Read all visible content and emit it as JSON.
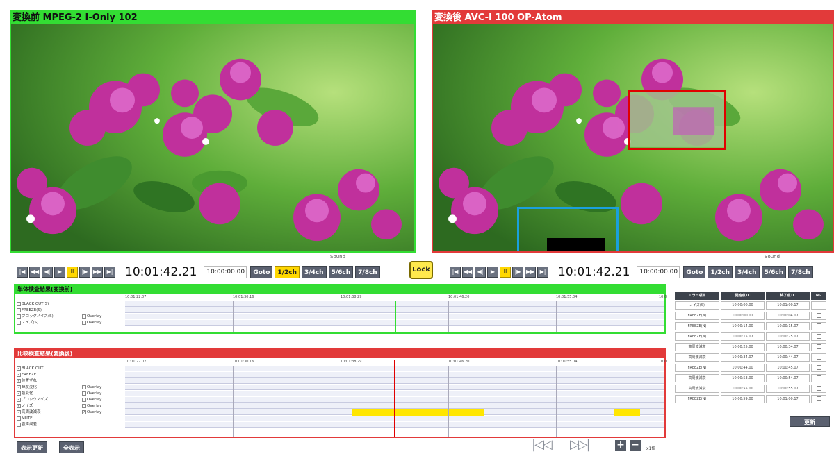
{
  "left_panel": {
    "title": "変換前 MPEG-2 I-Only 102"
  },
  "right_panel": {
    "title": "変換後 AVC-I 100 OP-Atom"
  },
  "sound_label": "Sound",
  "left_transport": {
    "timecode": "10:01:42.21",
    "input": "10:00:00.00",
    "goto": "Goto",
    "channels": [
      "1/2ch",
      "3/4ch",
      "5/6ch",
      "7/8ch"
    ],
    "selected_channel": "1/2ch"
  },
  "right_transport": {
    "timecode": "10:01:42.21",
    "input": "10:00:00.00",
    "goto": "Goto",
    "channels": [
      "1/2ch",
      "3/4ch",
      "5/6ch",
      "7/8ch"
    ],
    "selected_channel": "1/2ch"
  },
  "lock_label": "Lock",
  "single_panel": {
    "title": "単体検査結果(変換前)",
    "ticks": [
      "10:01:22.07",
      "10:01:30.16",
      "10:01:38.29",
      "10:01:46.20",
      "10:01:55.04",
      "10:0"
    ],
    "rows": [
      {
        "label": "BLACK OUT(S)",
        "checked": false,
        "overlay": false
      },
      {
        "label": "FREEZE(S)",
        "checked": false,
        "overlay": false
      },
      {
        "label": "ブロックノイズ(S)",
        "checked": false,
        "overlay": true
      },
      {
        "label": "ノイズ(S)",
        "checked": false,
        "overlay": true
      }
    ]
  },
  "compare_panel": {
    "title": "比較検査結果(変換後)",
    "ticks": [
      "10:01:22.07",
      "10:01:30.16",
      "10:01:38.29",
      "10:01:46.20",
      "10:01:55.04",
      "10:0"
    ],
    "rows": [
      {
        "label": "BLACK OUT",
        "checked": true,
        "overlay": false
      },
      {
        "label": "FREEZE",
        "checked": true,
        "overlay": false
      },
      {
        "label": "位置ずれ",
        "checked": true,
        "overlay": false
      },
      {
        "label": "輝度変化",
        "checked": true,
        "overlay": true
      },
      {
        "label": "色変化",
        "checked": true,
        "overlay": true
      },
      {
        "label": "ブロックノイズ",
        "checked": true,
        "overlay": true
      },
      {
        "label": "ノイズ",
        "checked": true,
        "overlay": true
      },
      {
        "label": "高周波減衰",
        "checked": true,
        "overlay": true,
        "overlay_checked": true
      },
      {
        "label": "MUTE",
        "checked": false,
        "overlay": false
      },
      {
        "label": "音声誤差",
        "checked": false,
        "overlay": false
      }
    ]
  },
  "overlay_label": "Overlay",
  "error_table": {
    "headers": [
      "エラー項目",
      "開始点TC",
      "終了点TC",
      "NG"
    ],
    "rows": [
      [
        "ノイズ(S)",
        "10:00:00.00",
        "10:01:00.17"
      ],
      [
        "FREEZE(N)",
        "10:00:00.01",
        "10:00:04.07"
      ],
      [
        "FREEZE(N)",
        "10:00:14.00",
        "10:00:15.07"
      ],
      [
        "FREEZE(N)",
        "10:00:15.07",
        "10:00:25.07"
      ],
      [
        "高周波減衰",
        "10:00:25.00",
        "10:00:34.07"
      ],
      [
        "高周波減衰",
        "10:00:34.07",
        "10:00:44.07"
      ],
      [
        "FREEZE(N)",
        "10:00:44.00",
        "10:00:45.07"
      ],
      [
        "高周波減衰",
        "10:00:53.00",
        "10:00:54.07"
      ],
      [
        "高周波減衰",
        "10:00:55.00",
        "10:00:55.07"
      ],
      [
        "FREEZE(N)",
        "10:00:59.00",
        "10:01:00.17"
      ]
    ],
    "update_button": "更新"
  },
  "bottom": {
    "refresh_button": "表示更新",
    "show_all_button": "全表示",
    "zoom_label": "x1倍"
  }
}
